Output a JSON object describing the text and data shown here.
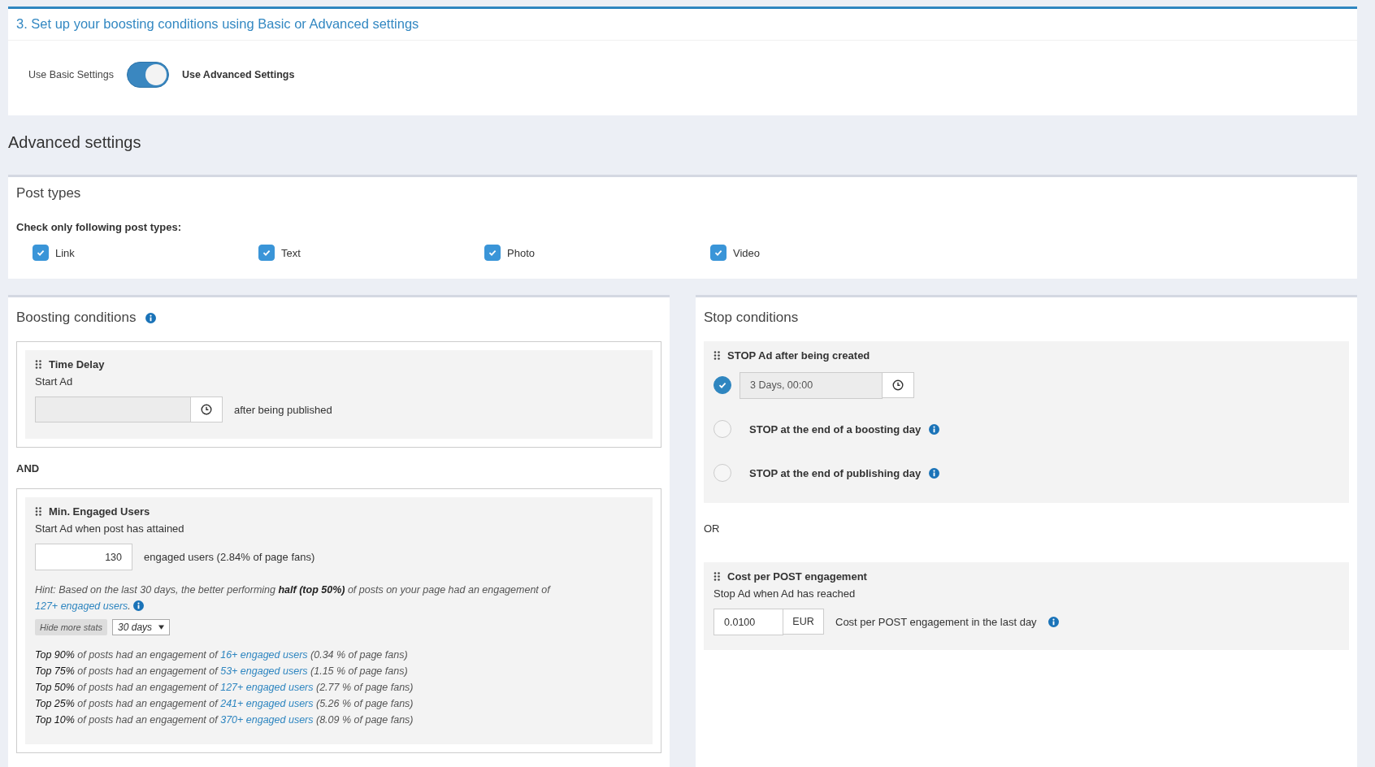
{
  "section_title": "3. Set up your boosting conditions using Basic or Advanced settings",
  "mode_toggle": {
    "off_label": "Use Basic Settings",
    "on_label": "Use Advanced Settings",
    "on": true
  },
  "advanced_heading": "Advanced settings",
  "post_types": {
    "title": "Post types",
    "instruction": "Check only following post types:",
    "options": [
      {
        "label": "Link",
        "checked": true
      },
      {
        "label": "Text",
        "checked": true
      },
      {
        "label": "Photo",
        "checked": true
      },
      {
        "label": "Video",
        "checked": true
      }
    ]
  },
  "boosting_conditions": {
    "title": "Boosting conditions",
    "time_delay": {
      "title": "Time Delay",
      "subtitle": "Start Ad",
      "suffix": "after being published"
    },
    "joiner": "AND",
    "min_engaged_users": {
      "title": "Min. Engaged Users",
      "subtitle": "Start Ad when post has attained",
      "value": "130",
      "suffix": "engaged users (2.84% of page fans)",
      "hint": "Hint: Based on the last 30 days, the better performing **half (top 50%)** of posts on your page had an engagement of",
      "hint_link": "127+ engaged users",
      "hint_end": ".",
      "stats_button": "Hide more stats",
      "period": "30 days",
      "stats": [
        {
          "top": "Top 90%",
          "text": "of posts had an engagement of",
          "link": "16+ engaged users",
          "tail": "(0.34 % of page fans)"
        },
        {
          "top": "Top 75%",
          "text": "of posts had an engagement of",
          "link": "53+ engaged users",
          "tail": "(1.15 % of page fans)"
        },
        {
          "top": "Top 50%",
          "text": "of posts had an engagement of",
          "link": "127+ engaged users",
          "tail": "(2.77 % of page fans)"
        },
        {
          "top": "Top 25%",
          "text": "of posts had an engagement of",
          "link": "241+ engaged users",
          "tail": "(5.26 % of page fans)"
        },
        {
          "top": "Top 10%",
          "text": "of posts had an engagement of",
          "link": "370+ engaged users",
          "tail": "(8.09 % of page fans)"
        }
      ]
    }
  },
  "stop_conditions": {
    "title": "Stop conditions",
    "stop_after": {
      "title": "STOP Ad after being created",
      "options": [
        {
          "kind": "duration",
          "value": "3 Days, 00:00",
          "selected": true
        },
        {
          "kind": "label",
          "label": "STOP at the end of a boosting day",
          "selected": false
        },
        {
          "kind": "label",
          "label": "STOP at the end of publishing day",
          "selected": false
        }
      ]
    },
    "joiner": "OR",
    "cost": {
      "title": "Cost per POST engagement",
      "subtitle": "Stop Ad when Ad has reached",
      "value": "0.0100",
      "currency": "EUR",
      "suffix": "Cost per POST engagement in the last day"
    }
  }
}
